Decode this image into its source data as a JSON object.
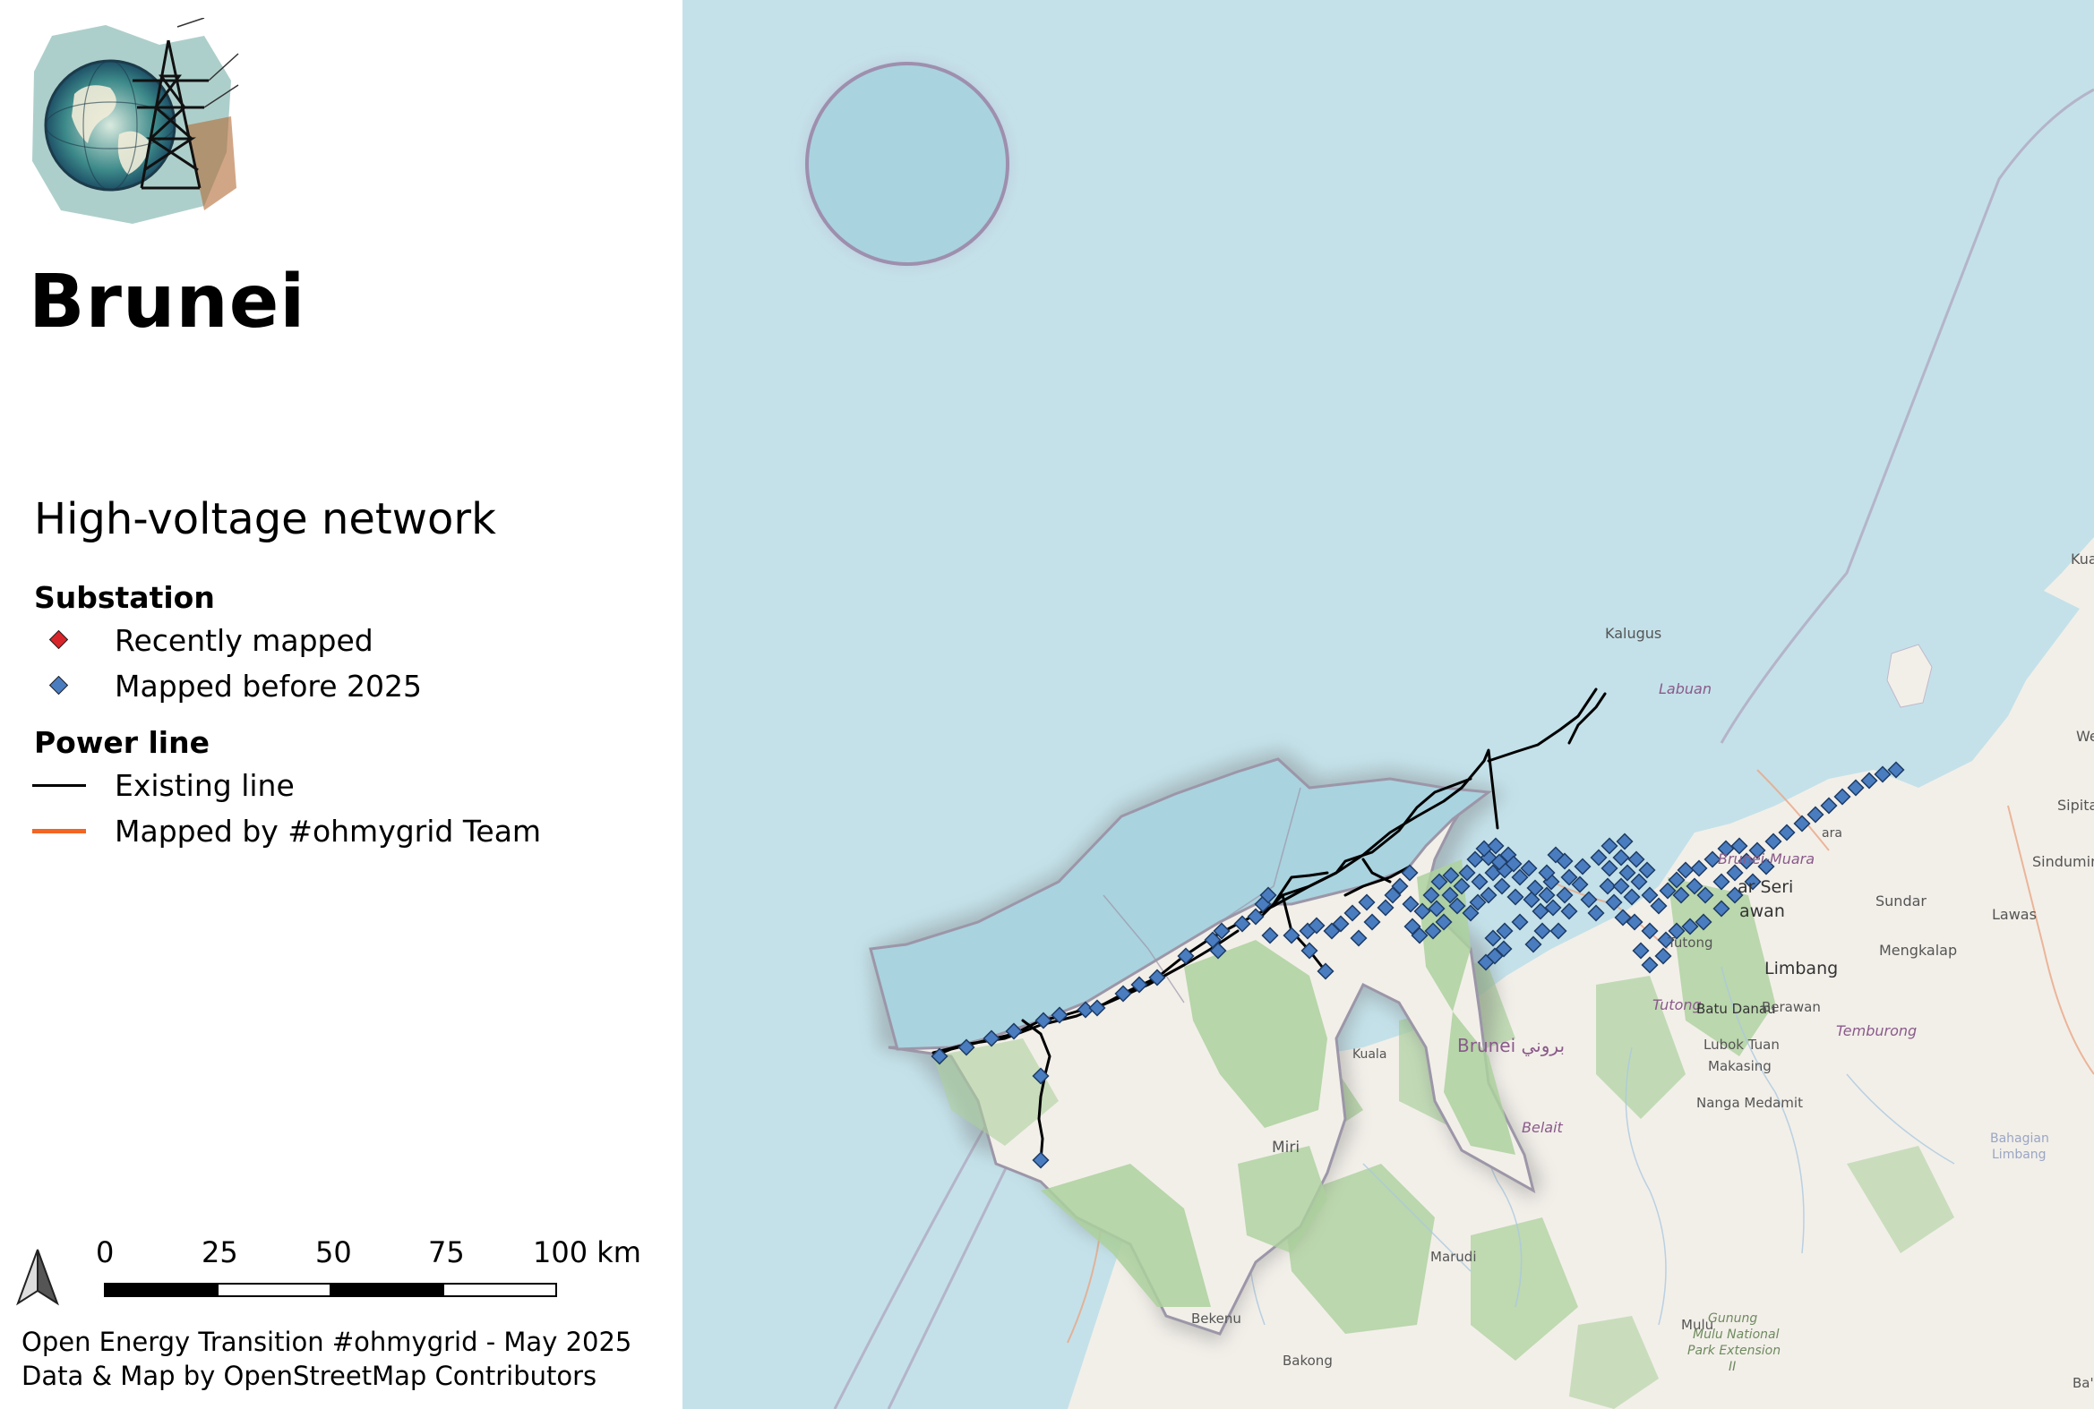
{
  "title": "Brunei",
  "legend": {
    "section_title": "High-voltage network",
    "substation": {
      "title": "Substation",
      "items": [
        {
          "label": "Recently mapped",
          "color": "#d7262b"
        },
        {
          "label": "Mapped before 2025",
          "color": "#4a7cc0"
        }
      ]
    },
    "power_line": {
      "title": "Power line",
      "items": [
        {
          "label": "Existing line",
          "color": "#000000"
        },
        {
          "label": "Mapped by #ohmygrid Team",
          "color": "#f26522"
        }
      ]
    }
  },
  "scale_bar": {
    "ticks": [
      "0",
      "25",
      "50",
      "75",
      "100 km"
    ]
  },
  "credits": {
    "line1": "Open Energy Transition #ohmygrid - May 2025",
    "line2": "Data & Map by OpenStreetMap Contributors"
  },
  "map": {
    "colors": {
      "sea": "#c4e1e9",
      "land": "#f2efe9",
      "forest": "#add19e",
      "highlight": "#a9d3df"
    },
    "places": {
      "kuala": "Kuala",
      "kalugus": "Kalugus",
      "labuan": "Labuan",
      "we": "We",
      "sipitang": "Sipitang",
      "sindumin": "Sindumin",
      "lawas": "Lawas",
      "sundar": "Sundar",
      "mengkalap": "Mengkalap",
      "brunei_muara": "Brunei-Muara",
      "bandar_seri": "ar Seri",
      "begawan": "awan",
      "muara": "ara",
      "tutong": "Tutong",
      "tutong_district": "Tutong",
      "limbang": "Limbang",
      "batu_danau": "Batu Danau",
      "berawan": "Berawan",
      "temburong": "Temburong",
      "lubok_tuan": "Lubok Tuan",
      "makasing": "Makasing",
      "nanga_medamit": "Nanga Medamit",
      "kuala_belait": "Kuala",
      "brunei_label": "Brunei بروني",
      "belait": "Belait",
      "miri": "Miri",
      "marudi": "Marudi",
      "bekenu": "Bekenu",
      "bakong": "Bakong",
      "mulu": "Mulu",
      "gunung_mulu": "Gunung",
      "gunung_mulu2": "Mulu National",
      "gunung_mulu3": "Park Extension",
      "gunung_mulu4": "II",
      "bahagian": "Bahagian",
      "limbang2": "Limbang",
      "ba": "Ba'"
    }
  }
}
